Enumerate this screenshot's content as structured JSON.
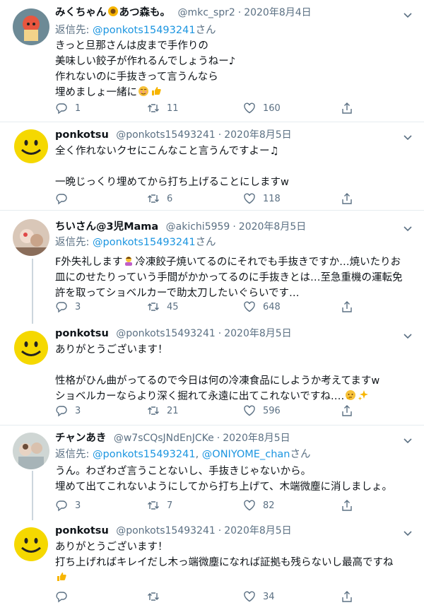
{
  "reply_prefix": "返信先: ",
  "reply_suffix": "さん",
  "reply_separator": ", ",
  "colors": {
    "link": "#1b95e0",
    "muted": "#5b7083",
    "text": "#0f1419",
    "divider": "#e6ecf0"
  },
  "tweets": [
    {
      "display_name": "みくちゃん",
      "display_name_after_emoji": "あつ森も。",
      "handle": "@mkc_spr2",
      "date": "2020年8月4日",
      "reply_to": [
        "@ponkots15493241"
      ],
      "lines": [
        "きっと旦那さんは皮まで手作りの",
        "美味しい餃子が作れるんでしょうねー♪",
        "作れないのに手抜きって言うんなら",
        "埋めましょ一緒に"
      ],
      "replies": "1",
      "retweets": "11",
      "likes": "160"
    },
    {
      "display_name": "ponkotsu",
      "handle": "@ponkots15493241",
      "date": "2020年8月5日",
      "lines": [
        "全く作れないクセにこんなこと言うんですよー♫",
        "",
        "一晩じっくり埋めてから打ち上げることにしますw"
      ],
      "replies": "",
      "retweets": "6",
      "likes": "118"
    },
    {
      "display_name": "ちいさん@3児Mama",
      "handle": "@akichi5959",
      "date": "2020年8月5日",
      "reply_to": [
        "@ponkots15493241"
      ],
      "lines": [
        "F外失礼します",
        "冷凍餃子焼いてるのにそれでも手抜きですか…焼いたりお",
        "皿にのせたりっていう手間がかかってるのに手抜きとは…至急重機の運転免",
        "許を取ってショベルカーで助太刀したいぐらいです…"
      ],
      "replies": "3",
      "retweets": "45",
      "likes": "648"
    },
    {
      "display_name": "ponkotsu",
      "handle": "@ponkots15493241",
      "date": "2020年8月5日",
      "lines": [
        "ありがとうございます！",
        "",
        "性格がひん曲がってるので今日は何の冷凍食品にしようか考えてますw",
        "ショベルカーならより深く掘れて永遠に出てこれないですね‥‥"
      ],
      "replies": "3",
      "retweets": "21",
      "likes": "596"
    },
    {
      "display_name": "チャンあき",
      "handle": "@w7sCQsJNdEnJCKe",
      "date": "2020年8月5日",
      "reply_to": [
        "@ponkots15493241",
        "@ONIYOME_chan"
      ],
      "lines": [
        "うん。わざわざ言うことないし、手抜きじゃないから。",
        "埋めて出てこれないようにしてから打ち上げて、木端微塵に消しましょ。"
      ],
      "replies": "3",
      "retweets": "7",
      "likes": "82"
    },
    {
      "display_name": "ponkotsu",
      "handle": "@ponkots15493241",
      "date": "2020年8月5日",
      "lines": [
        "ありがとうございます！",
        "打ち上げればキレイだし木っ端微塵になれば証拠も残らないし最高ですね"
      ],
      "replies": "",
      "retweets": "",
      "likes": "34"
    }
  ]
}
